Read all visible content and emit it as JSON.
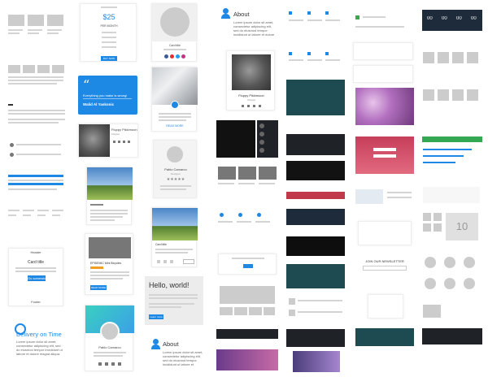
{
  "pricing": {
    "amount": "$25",
    "period": "PER MONTH",
    "button": "BUY NOW"
  },
  "profile_top": {
    "name": "Card title"
  },
  "about_top": {
    "title": "About",
    "text": "Lorem ipsum dolor sit amet, consectetur adipiscing elit, sed do eiusmod tempor incididunt ut labore et dolore magna aliqua."
  },
  "quote": {
    "text": "Everything you make is wrong!",
    "author": "Walid Al Yaskonic"
  },
  "kitten_card": {
    "name": "Fluppy Pikkimoon",
    "sub": "Kittgast"
  },
  "fluppy_small": {
    "name": "Fluppy Pikkimoon",
    "sub": "Kittgast"
  },
  "read_more": {
    "label": "READ MORE"
  },
  "profile_mid": {
    "name": "Pablo Camarco",
    "role": "Designer",
    "stars": "★★★★★"
  },
  "landscape": {
    "title": "Card title"
  },
  "blog": {
    "title": "EPIDEMIC Mini Bicycles",
    "button": "READ MORE"
  },
  "card_title_block": {
    "header": "Header",
    "title": "Card title",
    "button": "Go somewhere",
    "footer": "Footer"
  },
  "hero": {
    "title": "Hello, world!",
    "button": "Learn more"
  },
  "delivery": {
    "title": "Delivery on Time",
    "text": "Lorem ipsum dolor sit amet, consectetur adipiscing elit, sed do eiusmod tempor incididunt ut labore et dolore magna aliqua."
  },
  "about_bottom": {
    "title": "About",
    "text": "Lorem ipsum dolor sit amet, consectetur adipiscing elit, sed do eiusmod tempor incididunt ut labore et dolore magna aliqua."
  },
  "profile_bottom": {
    "name": "Pablo Camarco"
  },
  "newsletter": {
    "title": "JOIN OUR NEWSLETTER"
  },
  "number_tile": {
    "value": "10"
  },
  "countdown": {
    "values": [
      "00",
      "00",
      "00",
      "00"
    ]
  },
  "colors": {
    "accent": "#1e88e5",
    "dark": "#1f2328",
    "red": "#c0394b",
    "green": "#35a853"
  }
}
